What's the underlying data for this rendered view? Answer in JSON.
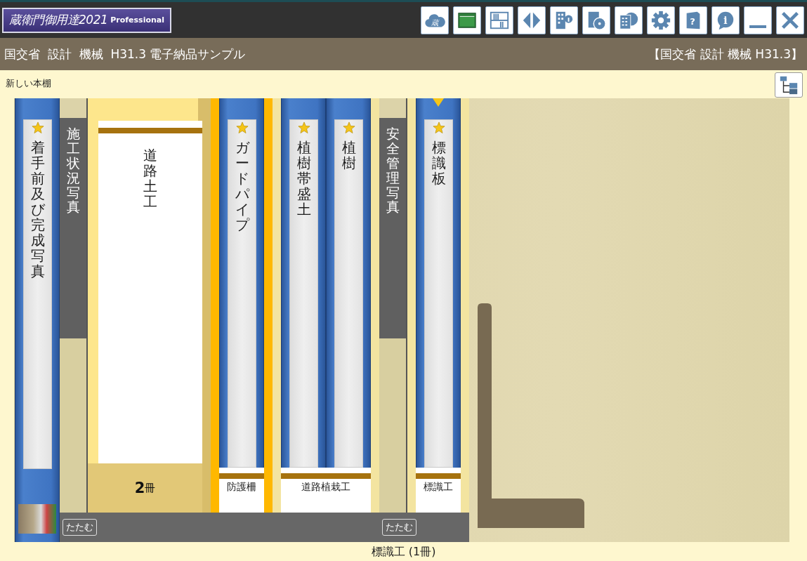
{
  "app": {
    "logo": "蔵衛門御用達2021",
    "edition": "Professional"
  },
  "toolbar": [
    {
      "kind": "cloud",
      "glyph": "蔵"
    },
    {
      "kind": "window"
    },
    {
      "kind": "bookshelf"
    },
    {
      "kind": "arrows"
    },
    {
      "kind": "building"
    },
    {
      "kind": "disc"
    },
    {
      "kind": "calculator"
    },
    {
      "kind": "settings"
    },
    {
      "kind": "help",
      "glyph": "?"
    },
    {
      "kind": "info",
      "glyph": "i"
    },
    {
      "kind": "minimize"
    },
    {
      "kind": "close"
    }
  ],
  "header": {
    "title": "国交省  設計  機械  H31.3 電子納品サンプル",
    "context": "【国交省 設計 機械 H31.3】"
  },
  "shelf": {
    "name": "新しい本棚",
    "items": [
      {
        "kind": "binder",
        "title": "着手前及び完成写真",
        "starred": true
      },
      {
        "kind": "divider",
        "title": "施工状況写真",
        "collapse_label": "たたむ",
        "groups": [
          {
            "kind": "folder",
            "title": "道路土工",
            "count": "**2**冊"
          },
          {
            "kind": "binders",
            "label": "防護柵",
            "selected": true,
            "binders": [
              {
                "title": "ガードパイプ",
                "starred": true,
                "current": false
              }
            ]
          },
          {
            "kind": "binders",
            "label": "道路植栽工",
            "selected": false,
            "binders": [
              {
                "title": "植樹帯盛土",
                "starred": true,
                "current": false
              },
              {
                "title": "植樹",
                "starred": true,
                "current": false
              }
            ]
          }
        ]
      },
      {
        "kind": "divider",
        "title": "安全管理写真",
        "collapse_label": "たたむ",
        "groups": [
          {
            "kind": "binders",
            "label": "標識工",
            "selected": false,
            "binders": [
              {
                "title": "標識板",
                "starred": true,
                "current": true
              }
            ]
          }
        ]
      }
    ]
  },
  "status": "標識工 (1冊)"
}
